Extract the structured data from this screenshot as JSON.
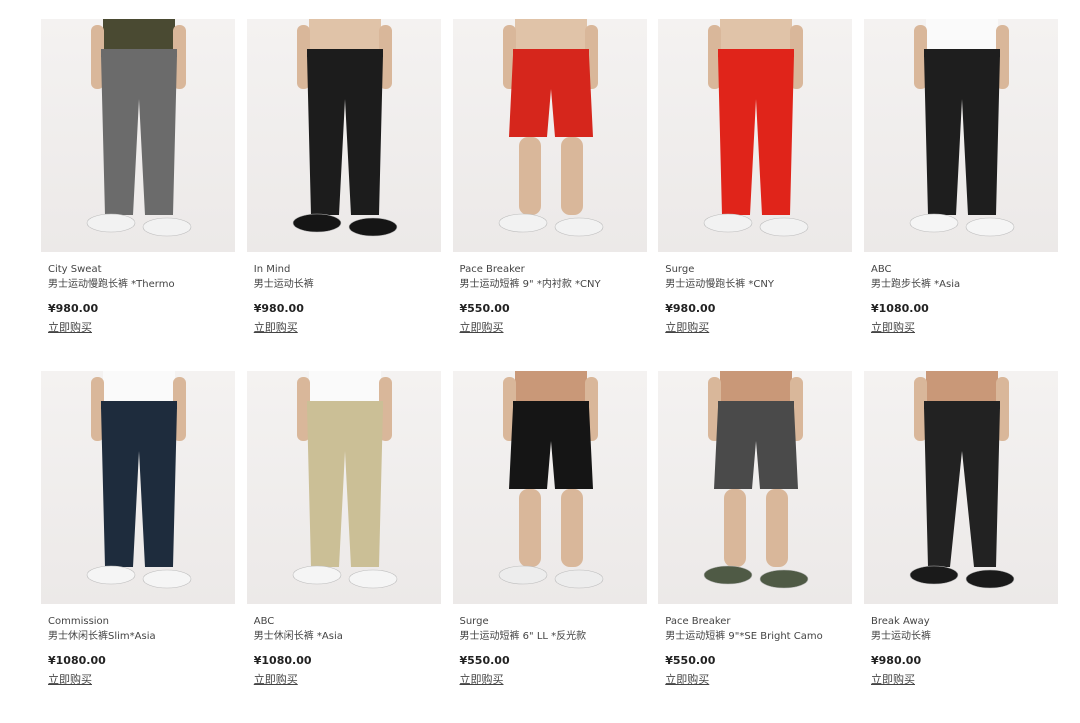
{
  "products": [
    {
      "name": "City Sweat",
      "desc": "男士运动慢跑长裤 *Thermo",
      "price": "¥980.00",
      "buy": "立即购买",
      "image": "model-gray-joggers",
      "top": "#4a4a32",
      "bottom": "#6b6b6b",
      "shoes": "#f2f2f2",
      "style": "jogger"
    },
    {
      "name": "In Mind",
      "desc": "男士运动长裤",
      "price": "¥980.00",
      "buy": "立即购买",
      "image": "model-black-pants",
      "top": "#e0c3a8",
      "bottom": "#1c1c1c",
      "shoes": "#151515",
      "style": "jogger"
    },
    {
      "name": "Pace Breaker",
      "desc": "男士运动短裤 9\" *内衬款 *CNY",
      "price": "¥550.00",
      "buy": "立即购买",
      "image": "model-red-shorts",
      "top": "#e0c3a8",
      "bottom": "#d6261c",
      "shoes": "#f2f2f2",
      "style": "shorts"
    },
    {
      "name": "Surge",
      "desc": "男士运动慢跑长裤 *CNY",
      "price": "¥980.00",
      "buy": "立即购买",
      "image": "model-red-joggers",
      "top": "#e0c3a8",
      "bottom": "#e0241a",
      "shoes": "#f2f2f2",
      "style": "jogger"
    },
    {
      "name": "ABC",
      "desc": "男士跑步长裤 *Asia",
      "price": "¥1080.00",
      "buy": "立即购买",
      "image": "model-black-joggers",
      "top": "#fafafa",
      "bottom": "#1e1e1e",
      "shoes": "#f5f5f5",
      "style": "jogger"
    },
    {
      "name": "Commission",
      "desc": "男士休闲长裤Slim*Asia",
      "price": "¥1080.00",
      "buy": "立即购买",
      "image": "model-navy-trousers",
      "top": "#fafafa",
      "bottom": "#1e2c3d",
      "shoes": "#f5f5f5",
      "style": "trouser"
    },
    {
      "name": "ABC",
      "desc": "男士休闲长裤 *Asia",
      "price": "¥1080.00",
      "buy": "立即购买",
      "image": "model-khaki-trousers",
      "top": "#fafafa",
      "bottom": "#cbbf96",
      "shoes": "#f5f5f5",
      "style": "trouser"
    },
    {
      "name": "Surge",
      "desc": "男士运动短裤 6\" LL *反光款",
      "price": "¥550.00",
      "buy": "立即购买",
      "image": "model-black-shorts",
      "top": "#c99878",
      "bottom": "#151515",
      "shoes": "#ededed",
      "style": "shorts"
    },
    {
      "name": "Pace Breaker",
      "desc": "男士运动短裤 9\"*SE Bright Camo",
      "price": "¥550.00",
      "buy": "立即购买",
      "image": "model-camo-shorts",
      "top": "#c99878",
      "bottom": "#4a4a4a",
      "shoes": "#4f5a45",
      "style": "shorts"
    },
    {
      "name": "Break Away",
      "desc": "男士运动长裤",
      "price": "¥980.00",
      "buy": "立即购买",
      "image": "model-black-tights",
      "top": "#c99878",
      "bottom": "#222222",
      "shoes": "#1a1a1a",
      "style": "tight"
    }
  ]
}
